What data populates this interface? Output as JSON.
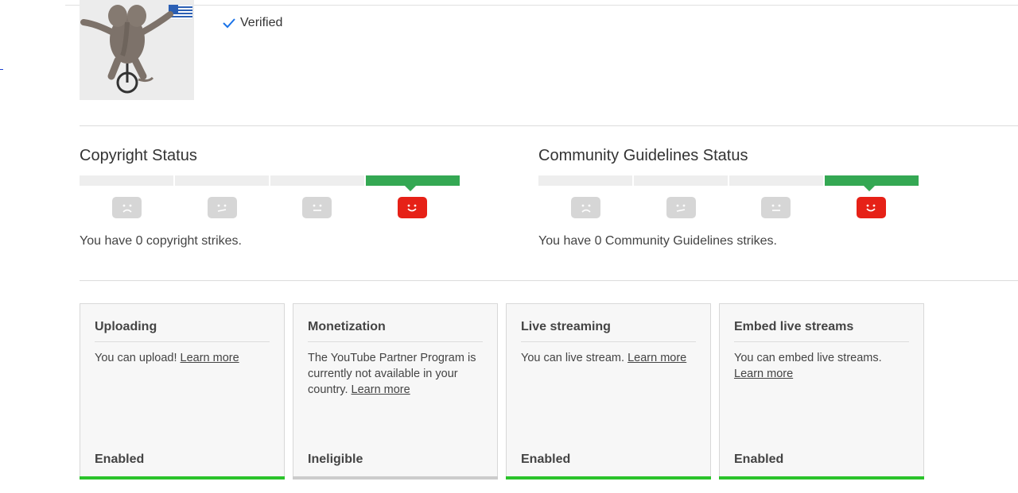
{
  "channel": {
    "verified_label": "Verified"
  },
  "copyright": {
    "title": "Copyright Status",
    "message": "You have 0 copyright strikes."
  },
  "community": {
    "title": "Community Guidelines Status",
    "message": "You have 0 Community Guidelines strikes."
  },
  "strike_level": {
    "copyright_active_index": 3,
    "community_active_index": 3
  },
  "colors": {
    "accent_green": "#34a853",
    "face_red": "#e62117",
    "enabled_green": "#2bc32b",
    "ineligible_gray": "#cccccc"
  },
  "features": [
    {
      "title": "Uploading",
      "text": "You can upload!",
      "link": "Learn more",
      "state": "Enabled"
    },
    {
      "title": "Monetization",
      "text": "The YouTube Partner Program is currently not available in your country.",
      "link": "Learn more",
      "state": "Ineligible"
    },
    {
      "title": "Live streaming",
      "text": "You can live stream.",
      "link": "Learn more",
      "state": "Enabled"
    },
    {
      "title": "Embed live streams",
      "text": "You can embed live streams.",
      "link": "Learn more",
      "state": "Enabled"
    }
  ]
}
